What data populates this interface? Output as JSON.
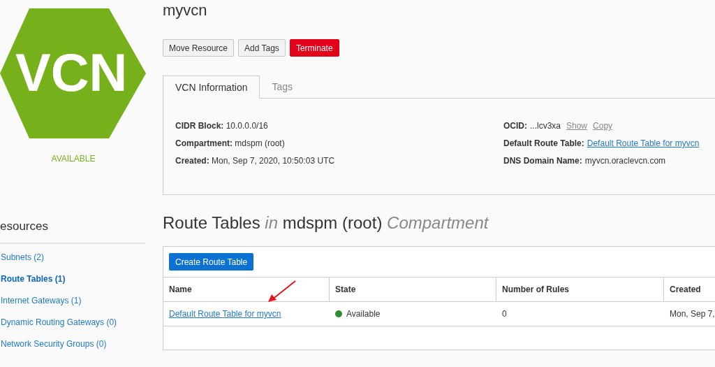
{
  "logo": {
    "text": "VCN",
    "status": "AVAILABLE"
  },
  "title": "myvcn",
  "actions": [
    {
      "label": "Move Resource",
      "kind": "default"
    },
    {
      "label": "Add Tags",
      "kind": "default"
    },
    {
      "label": "Terminate",
      "kind": "danger"
    }
  ],
  "tabs": [
    {
      "label": "VCN Information",
      "selected": true
    },
    {
      "label": "Tags",
      "selected": false
    }
  ],
  "details_left": [
    {
      "label": "CIDR Block:",
      "value": "10.0.0.0/16"
    },
    {
      "label": "Compartment:",
      "value": "mdspm (root)"
    },
    {
      "label": "Created:",
      "value": "Mon, Sep 7, 2020, 10:50:03 UTC"
    }
  ],
  "details_right": [
    {
      "label": "OCID:",
      "value": "...lcv3xa",
      "kind": "ocid",
      "links": [
        "Show",
        "Copy"
      ]
    },
    {
      "label": "Default Route Table:",
      "value": "Default Route Table for myvcn",
      "kind": "link"
    },
    {
      "label": "DNS Domain Name:",
      "value": "myvcn.oraclevcn.com",
      "kind": "text"
    }
  ],
  "sidebar": {
    "title": "esources",
    "items": [
      {
        "label": "Subnets (2)",
        "selected": false
      },
      {
        "label": "Route Tables (1)",
        "selected": true
      },
      {
        "label": "Internet Gateways (1)",
        "selected": false
      },
      {
        "label": "Dynamic Routing Gateways (0)",
        "selected": false
      },
      {
        "label": "Network Security Groups (0)",
        "selected": false
      }
    ]
  },
  "section": {
    "title": "Route Tables",
    "in": "in",
    "compartment": "mdspm (root)",
    "suffix": "Compartment"
  },
  "create_button": "Create Route Table",
  "table": {
    "columns": [
      "Name",
      "State",
      "Number of Rules",
      "Created"
    ],
    "rows": [
      {
        "name": "Default Route Table for myvcn",
        "state": "Available",
        "color": "#2e8b2e",
        "rules": "0",
        "created": "Mon, Sep 7,"
      }
    ]
  },
  "annotation": {
    "kind": "arrow"
  }
}
